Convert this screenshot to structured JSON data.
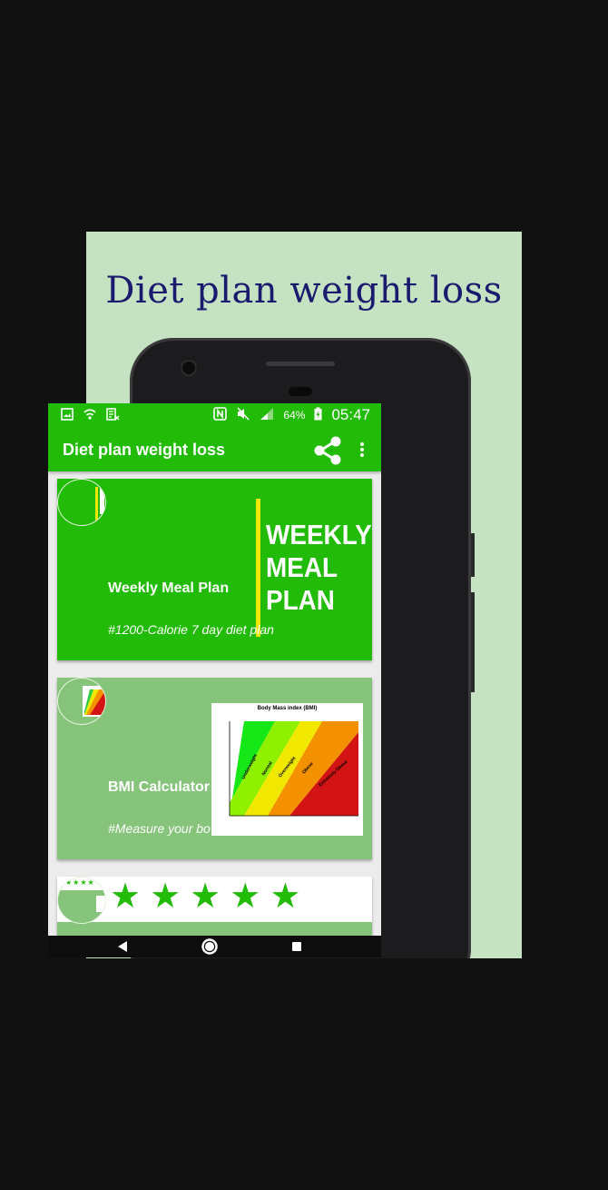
{
  "promo": {
    "title": "Diet plan weight loss"
  },
  "status_bar": {
    "battery": "64%",
    "time": "05:47"
  },
  "app_bar": {
    "title": "Diet plan weight loss",
    "share_icon": "share-icon",
    "menu_icon": "overflow-menu-icon"
  },
  "cards": [
    {
      "title": "Weekly Meal Plan",
      "subtitle": "#1200-Calorie 7 day diet plan",
      "image_text": [
        "WEEKLY",
        "MEAL",
        "PLAN"
      ],
      "color": "#22bb07"
    },
    {
      "title": "BMI Calculator",
      "subtitle": "#Measure your bo",
      "chart_title": "Body Mass index (BMI)",
      "chart_labels": [
        "Underweight",
        "Normal",
        "Overweight",
        "Obese",
        "Extremely Obese"
      ],
      "color": "#85c47a"
    },
    {
      "stars": 5,
      "color": "#ffffff"
    }
  ],
  "colors": {
    "accent": "#22bb07",
    "card_light": "#85c47a",
    "promo_bg": "#c5e3c2",
    "promo_title": "#1a1a6e"
  }
}
